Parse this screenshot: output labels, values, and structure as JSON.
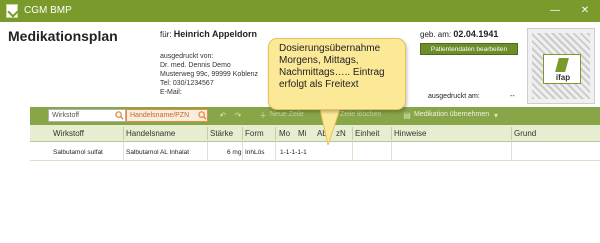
{
  "window": {
    "title": "CGM BMP",
    "min": "—",
    "close": "✕"
  },
  "header": {
    "title": "Medikationsplan",
    "patient_prefix": "für:",
    "patient_name": "Heinrich Appeldorn",
    "printed_by_label": "ausgedruckt von:",
    "doctor": "Dr. med. Dennis Demo",
    "address": "Musterweg 99c, 99999 Koblenz",
    "phone": "Tel: 030/1234567",
    "email": "E-Mail:",
    "dob_label": "geb. am:",
    "dob": "02.04.1941",
    "edit_button": "Patientendaten bearbeiten",
    "printed_at_label": "ausgedruckt am:",
    "printed_at_value": "--",
    "logo_text": "ifap"
  },
  "callout": {
    "text": "Dosierungsübernahme Morgens, Mittags, Nachmittags….. Eintrag erfolgt als Freitext"
  },
  "toolbar": {
    "search_wirkstoff_placeholder": "Wirkstoff",
    "search_handelsname_placeholder": "Handelsname/PZN",
    "new_entry": "Neue Zeile",
    "delete_entry": "Zeile löschen",
    "take_over": "Medikation übernehmen"
  },
  "table": {
    "columns": [
      "Wirkstoff",
      "Handelsname",
      "Stärke",
      "Form",
      "Mo",
      "Mi",
      "Ab",
      "zN",
      "Einheit",
      "Hinweise",
      "Grund"
    ],
    "rows": [
      {
        "wirkstoff": "Salbutamol sulfat",
        "handelsname": "Salbutamol AL Inhalat",
        "staerke": "6 mg",
        "form": "InhLös",
        "dosierung": "1-1-1-1-1"
      }
    ]
  },
  "colors": {
    "titlebar": "#7a9a2c",
    "toolbar": "#88a548",
    "header_row": "#e6edd0",
    "callout": "#fbe997",
    "accent_orange": "#e78a3c"
  }
}
